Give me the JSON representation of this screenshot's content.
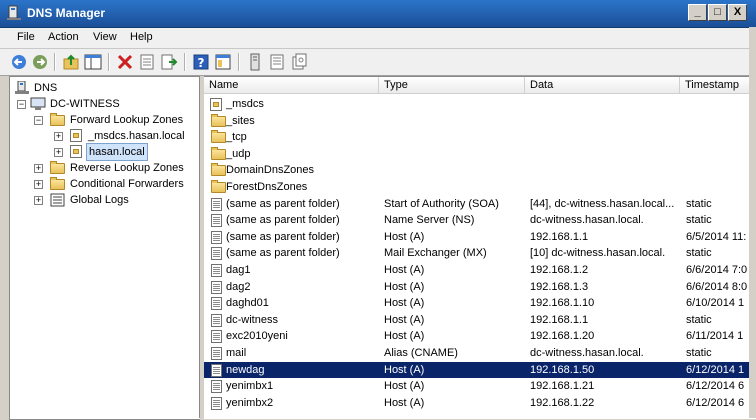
{
  "window": {
    "title": "DNS Manager",
    "controls": {
      "minimize": "_",
      "maximize": "□",
      "close": "X"
    }
  },
  "menu": [
    "File",
    "Action",
    "View",
    "Help"
  ],
  "toolbar": [
    "back-icon",
    "forward-icon",
    "up-icon",
    "show-hide-tree-icon",
    "delete-icon",
    "properties-icon",
    "export-icon",
    "help-icon",
    "details-icon",
    "list-icon",
    "refresh-icon"
  ],
  "tree": {
    "root": "DNS",
    "server": "DC-WITNESS",
    "forward": "Forward Lookup Zones",
    "zone1": "_msdcs.hasan.local",
    "zone2": "hasan.local",
    "reverse": "Reverse Lookup Zones",
    "conditional": "Conditional Forwarders",
    "logs": "Global Logs"
  },
  "columns": {
    "name": "Name",
    "type": "Type",
    "data": "Data",
    "timestamp": "Timestamp"
  },
  "rows": [
    {
      "icon": "dns-zone-icon",
      "name": "_msdcs",
      "type": "",
      "data": "",
      "timestamp": ""
    },
    {
      "icon": "folder-icon",
      "name": "_sites",
      "type": "",
      "data": "",
      "timestamp": ""
    },
    {
      "icon": "folder-icon",
      "name": "_tcp",
      "type": "",
      "data": "",
      "timestamp": ""
    },
    {
      "icon": "folder-icon",
      "name": "_udp",
      "type": "",
      "data": "",
      "timestamp": ""
    },
    {
      "icon": "folder-icon",
      "name": "DomainDnsZones",
      "type": "",
      "data": "",
      "timestamp": ""
    },
    {
      "icon": "folder-icon",
      "name": "ForestDnsZones",
      "type": "",
      "data": "",
      "timestamp": ""
    },
    {
      "icon": "record-icon",
      "name": "(same as parent folder)",
      "type": "Start of Authority (SOA)",
      "data": "[44], dc-witness.hasan.local...",
      "timestamp": "static"
    },
    {
      "icon": "record-icon",
      "name": "(same as parent folder)",
      "type": "Name Server (NS)",
      "data": "dc-witness.hasan.local.",
      "timestamp": "static"
    },
    {
      "icon": "record-icon",
      "name": "(same as parent folder)",
      "type": "Host (A)",
      "data": "192.168.1.1",
      "timestamp": "6/5/2014 11:"
    },
    {
      "icon": "record-icon",
      "name": "(same as parent folder)",
      "type": "Mail Exchanger (MX)",
      "data": "[10]  dc-witness.hasan.local.",
      "timestamp": "static"
    },
    {
      "icon": "record-icon",
      "name": "dag1",
      "type": "Host (A)",
      "data": "192.168.1.2",
      "timestamp": "6/6/2014 7:0"
    },
    {
      "icon": "record-icon",
      "name": "dag2",
      "type": "Host (A)",
      "data": "192.168.1.3",
      "timestamp": "6/6/2014 8:0"
    },
    {
      "icon": "record-icon",
      "name": "daghd01",
      "type": "Host (A)",
      "data": "192.168.1.10",
      "timestamp": "6/10/2014 1"
    },
    {
      "icon": "record-icon",
      "name": "dc-witness",
      "type": "Host (A)",
      "data": "192.168.1.1",
      "timestamp": "static"
    },
    {
      "icon": "record-icon",
      "name": "exc2010yeni",
      "type": "Host (A)",
      "data": "192.168.1.20",
      "timestamp": "6/11/2014 1"
    },
    {
      "icon": "record-icon",
      "name": "mail",
      "type": "Alias (CNAME)",
      "data": "dc-witness.hasan.local.",
      "timestamp": "static"
    },
    {
      "icon": "record-icon",
      "name": "newdag",
      "type": "Host (A)",
      "data": "192.168.1.50",
      "timestamp": "6/12/2014 1",
      "selected": true
    },
    {
      "icon": "record-icon",
      "name": "yenimbx1",
      "type": "Host (A)",
      "data": "192.168.1.21",
      "timestamp": "6/12/2014 6"
    },
    {
      "icon": "record-icon",
      "name": "yenimbx2",
      "type": "Host (A)",
      "data": "192.168.1.22",
      "timestamp": "6/12/2014 6"
    }
  ],
  "colors": {
    "titlebar": "#1f5ea8",
    "selection": "#0a246a",
    "delete": "#cc1f1f"
  }
}
